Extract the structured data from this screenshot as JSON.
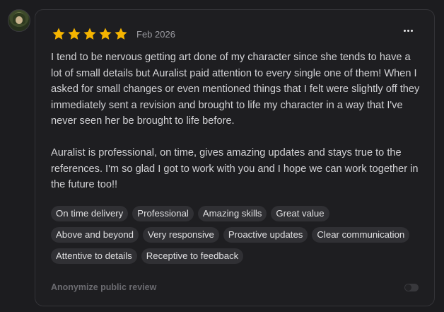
{
  "review": {
    "rating": 5,
    "max_rating": 5,
    "star_color": "#f5b400",
    "date": "Feb 2026",
    "paragraphs": [
      "I tend to be nervous getting art done of my character since she tends to have a lot of small details but Auralist paid attention to every single one of them! When I asked for small changes or even mentioned things that I felt were slightly off they immediately sent a revision and brought to life my character in a way that I've never seen her be brought to life before.",
      "Auralist is professional, on time, gives amazing updates and stays true to the references. I'm so glad I got to work with you and I hope we can work together in the future too!!"
    ],
    "tags": [
      "On time delivery",
      "Professional",
      "Amazing skills",
      "Great value",
      "Above and beyond",
      "Very responsive",
      "Proactive updates",
      "Clear communication",
      "Attentive to details",
      "Receptive to feedback"
    ]
  },
  "footer": {
    "anonymize_label": "Anonymize public review",
    "anonymize_enabled": false
  },
  "icons": {
    "avatar": "user-avatar",
    "menu": "more-options-icon",
    "star": "star-icon"
  }
}
